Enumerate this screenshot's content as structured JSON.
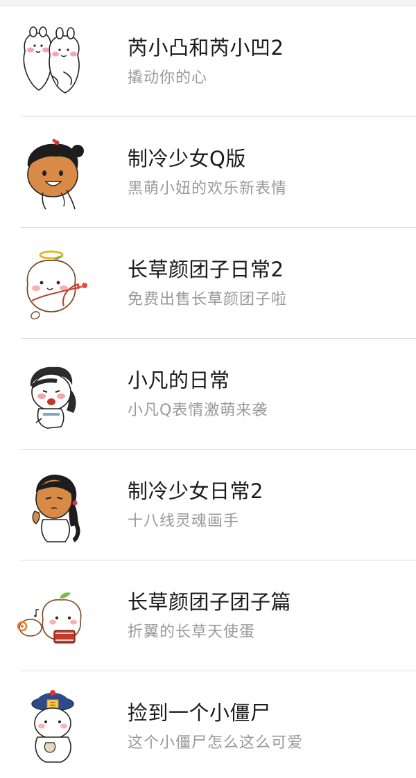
{
  "sticker_list": {
    "items": [
      {
        "title": "芮小凸和芮小凹2",
        "subtitle": "撬动你的心",
        "icon": "twin-bunnies-sticker-icon"
      },
      {
        "title": "制冷少女Q版",
        "subtitle": "黑萌小妞的欢乐新表情",
        "icon": "dark-girl-sticker-icon"
      },
      {
        "title": "长草颜团子日常2",
        "subtitle": "免费出售长草颜团子啦",
        "icon": "cupid-dumpling-sticker-icon"
      },
      {
        "title": "小凡的日常",
        "subtitle": "小凡Q表情激萌来袭",
        "icon": "backpack-boy-sticker-icon"
      },
      {
        "title": "制冷少女日常2",
        "subtitle": "十八线灵魂画手",
        "icon": "braided-girl-sticker-icon"
      },
      {
        "title": "长草颜团子团子篇",
        "subtitle": "折翼的长草天使蛋",
        "icon": "dumpling-drummer-sticker-icon"
      },
      {
        "title": "捡到一个小僵尸",
        "subtitle": "这个小僵尸怎么这么可爱",
        "icon": "baby-zombie-sticker-icon"
      }
    ]
  }
}
